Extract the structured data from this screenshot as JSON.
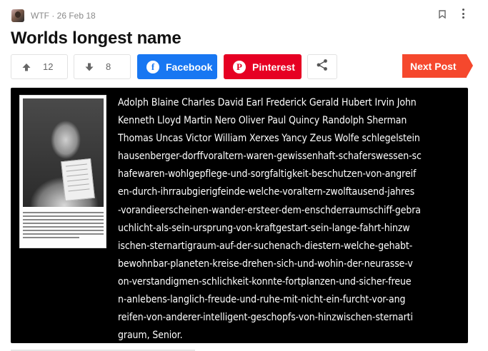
{
  "post": {
    "category": "WTF",
    "date": "26 Feb 18",
    "meta_separator": " · ",
    "title": "Worlds longest name"
  },
  "votes": {
    "upvotes": "12",
    "downvotes": "8"
  },
  "share": {
    "facebook_label": "Facebook",
    "pinterest_label": "Pinterest"
  },
  "navigation": {
    "next_post_label": "Next Post"
  },
  "image": {
    "name_lines": [
      "Adolph Blaine Charles David Earl Frederick Gerald Hubert Irvin John",
      "Kenneth Lloyd Martin Nero Oliver Paul Quincy Randolph Sherman",
      "Thomas Uncas Victor William Xerxes Yancy Zeus Wolfe schlegelstein",
      "hausenberger-dorffvoraltern-waren-gewissenhaft-schaferswessen-sc",
      "hafewaren-wohlgepflege-und-sorgfaltigkeit-beschutzen-von-angreif",
      "en-durch-ihrraubgierigfeinde-welche-voraltern-zwolftausend-jahres",
      "-vorandieerscheinen-wander-ersteer-dem-enschderraumschiff-gebra",
      "uchlicht-als-sein-ursprung-von-kraftgestart-sein-lange-fahrt-hinzw",
      "ischen-sternartigraum-auf-der-suchenach-diestern-welche-gehabt-",
      "bewohnbar-planeten-kreise-drehen-sich-und-wohin-der-neurasse-v",
      "on-verstandigmen-schlichkeit-konnte-fortplanzen-und-sicher-freue",
      "n-anlebens-langlich-freude-und-ruhe-mit-nicht-ein-furcht-vor-ang",
      "reifen-von-anderer-intelligent-geschopfs-von-hinzwischen-sternarti",
      "graum, Senior."
    ]
  },
  "colors": {
    "facebook": "#1877f2",
    "pinterest": "#e60023",
    "next_post": "#f5482d",
    "image_background": "#000000"
  },
  "icons": {
    "upvote": "arrow-up-icon",
    "downvote": "arrow-down-icon",
    "facebook": "facebook-icon",
    "pinterest": "pinterest-icon",
    "share": "share-icon",
    "bookmark": "bookmark-icon",
    "menu": "more-vertical-icon"
  }
}
